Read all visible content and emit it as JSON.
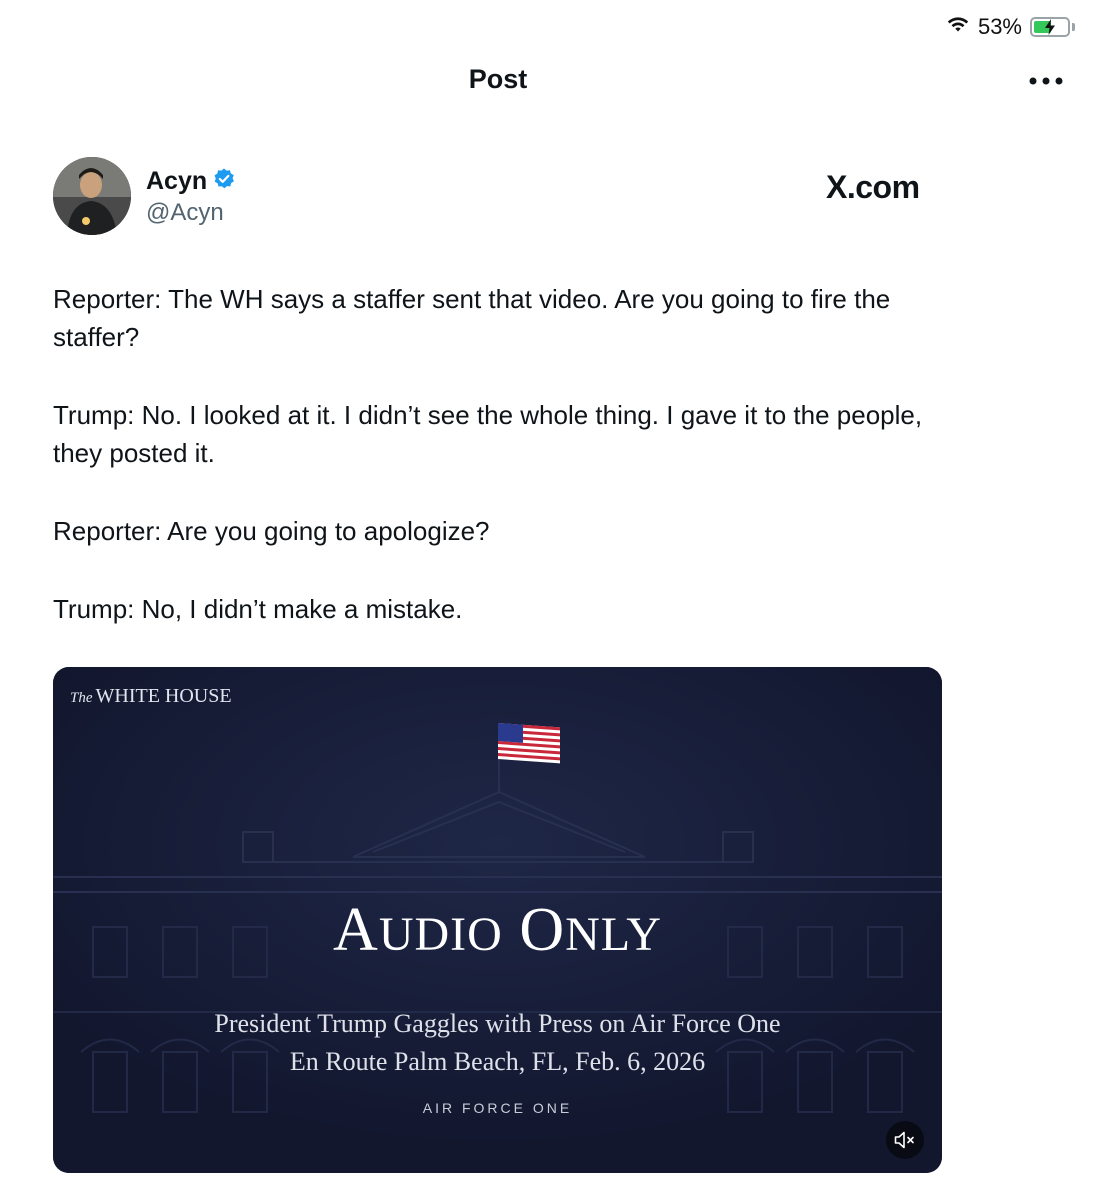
{
  "status_bar": {
    "battery_percent_label": "53%",
    "battery_level": 0.53,
    "wifi_icon": "wifi-icon",
    "battery_icon": "battery-charging-icon"
  },
  "header": {
    "title": "Post",
    "more_icon": "more-horizontal-icon"
  },
  "author": {
    "name": "Acyn",
    "handle": "@Acyn",
    "verified_icon": "verified-badge-icon"
  },
  "watermark": {
    "site": "X.com"
  },
  "post": {
    "paragraphs": [
      "Reporter: The WH says a staffer sent that video. Are you going to fire the staffer?",
      "Trump: No. I looked at it. I didn’t see the whole thing. I gave it to the people, they posted it.",
      "Reporter: Are you going to apologize?",
      "Trump: No, I didn’t make a mistake."
    ]
  },
  "media": {
    "logo_the": "The",
    "logo_name": "WHITE HOUSE",
    "title_a_initial": "A",
    "title_a_rest": "UDIO",
    "title_o_initial": "O",
    "title_o_rest": "NLY",
    "subtitle_line1": "President Trump Gaggles with Press on Air Force One",
    "subtitle_line2": "En Route Palm Beach, FL, Feb. 6, 2026",
    "caption": "AIR FORCE ONE",
    "mute_icon": "speaker-muted-icon",
    "flag_icon": "us-flag-icon",
    "background_color": "#141a35"
  }
}
